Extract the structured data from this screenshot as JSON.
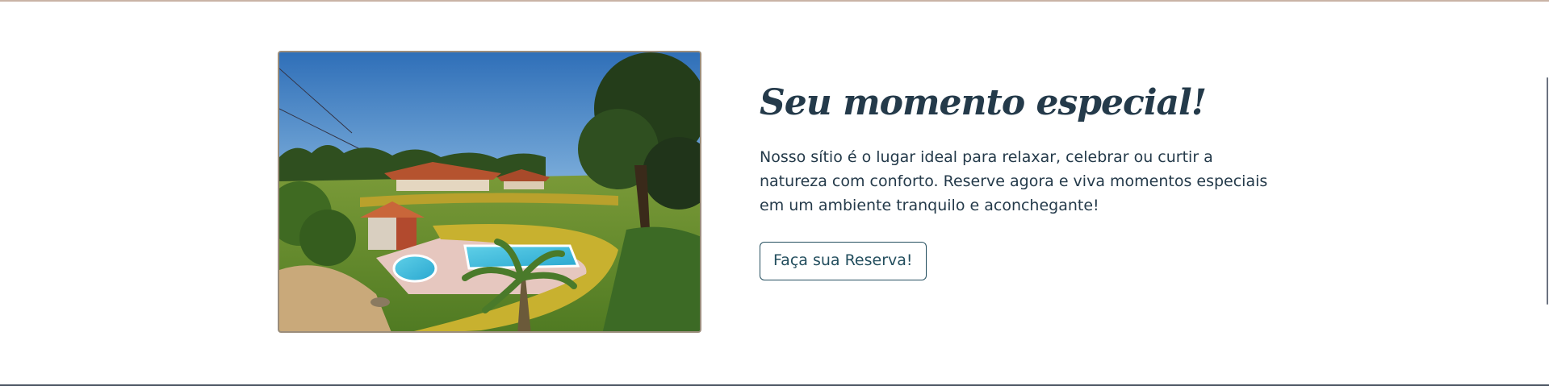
{
  "section": {
    "heading": "Seu momento especial!",
    "description": "Nosso sítio é o lugar ideal para relaxar, celebrar ou curtir a natureza com conforto. Reserve agora e viva momentos especiais em um ambiente tranquilo e aconchegante!",
    "cta_label": "Faça sua Reserva!"
  },
  "colors": {
    "heading": "#243a4a",
    "text": "#243a4a",
    "button_border": "#234e5e",
    "image_border": "#9b8d7c",
    "top_rule": "#c9b3a6",
    "bottom_rule": "#4b5563"
  },
  "image": {
    "subject": "country-house-pool-garden-photo"
  }
}
